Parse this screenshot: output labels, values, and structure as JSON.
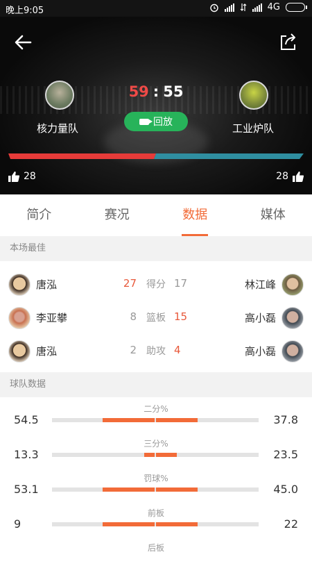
{
  "status_bar": {
    "time": "晚上9:05",
    "network": "4G"
  },
  "match": {
    "home_team": "核力量队",
    "away_team": "工业炉队",
    "home_score": "59",
    "separator": ":",
    "away_score": "55",
    "replay_label": "回放",
    "home_likes": "28",
    "away_likes": "28",
    "home_share": 0.5,
    "colors": {
      "home": "#e63b39",
      "away": "#2f8ea0",
      "accent": "#f26b38",
      "replay": "#27b35a"
    }
  },
  "tabs": [
    {
      "label": "简介",
      "active": false
    },
    {
      "label": "赛况",
      "active": false
    },
    {
      "label": "数据",
      "active": true
    },
    {
      "label": "媒体",
      "active": false
    }
  ],
  "best": {
    "header": "本场最佳",
    "rows": [
      {
        "home_player": "唐泓",
        "home_value": "27",
        "stat": "得分",
        "away_value": "17",
        "away_player": "林江峰",
        "winner": "home"
      },
      {
        "home_player": "李亚攀",
        "home_value": "8",
        "stat": "篮板",
        "away_value": "15",
        "away_player": "高小磊",
        "winner": "away"
      },
      {
        "home_player": "唐泓",
        "home_value": "2",
        "stat": "助攻",
        "away_value": "4",
        "away_player": "高小磊",
        "winner": "away"
      }
    ]
  },
  "team_stats": {
    "header": "球队数据",
    "rows": [
      {
        "label": "二分%",
        "home": "54.5",
        "away": "37.8",
        "home_frac": 0.5,
        "away_frac": 0.4
      },
      {
        "label": "三分%",
        "home": "13.3",
        "away": "23.5",
        "home_frac": 0.1,
        "away_frac": 0.2
      },
      {
        "label": "罚球%",
        "home": "53.1",
        "away": "45.0",
        "home_frac": 0.5,
        "away_frac": 0.4
      },
      {
        "label": "前板",
        "home": "9",
        "away": "22",
        "home_frac": 0.5,
        "away_frac": 0.4
      },
      {
        "label": "后板",
        "home": "",
        "away": "",
        "home_frac": 0,
        "away_frac": 0
      }
    ]
  }
}
